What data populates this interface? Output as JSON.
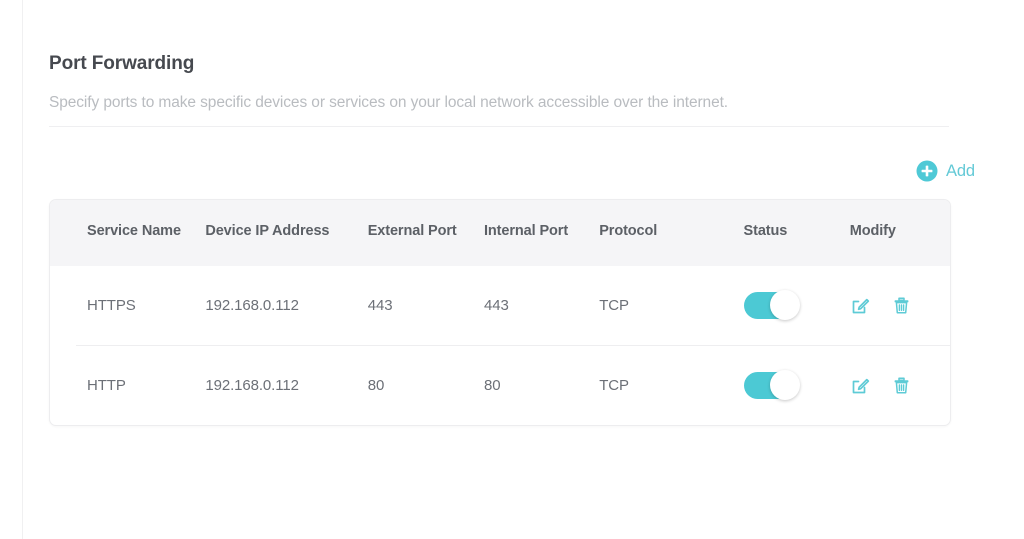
{
  "page": {
    "title": "Port Forwarding",
    "description": "Specify ports to make specific devices or services on your local network accessible over the internet."
  },
  "toolbar": {
    "add_label": "Add",
    "add_icon": "plus-circle-icon"
  },
  "colors": {
    "accent": "#4cc9d4",
    "add_text": "#63c9d6",
    "title_text": "#46494f",
    "description_text": "#b9bcc0",
    "header_background": "#f5f5f7",
    "header_text": "#5c6066",
    "cell_text": "#6c7077",
    "border": "#ededef"
  },
  "table": {
    "columns": [
      "Service Name",
      "Device IP Address",
      "External Port",
      "Internal Port",
      "Protocol",
      "Status",
      "Modify"
    ],
    "rows": [
      {
        "service_name": "HTTPS",
        "device_ip": "192.168.0.112",
        "external_port": "443",
        "internal_port": "443",
        "protocol": "TCP",
        "status_enabled": true,
        "edit_icon": "edit-pencil-icon",
        "delete_icon": "trash-icon"
      },
      {
        "service_name": "HTTP",
        "device_ip": "192.168.0.112",
        "external_port": "80",
        "internal_port": "80",
        "protocol": "TCP",
        "status_enabled": true,
        "edit_icon": "edit-pencil-icon",
        "delete_icon": "trash-icon"
      }
    ]
  }
}
